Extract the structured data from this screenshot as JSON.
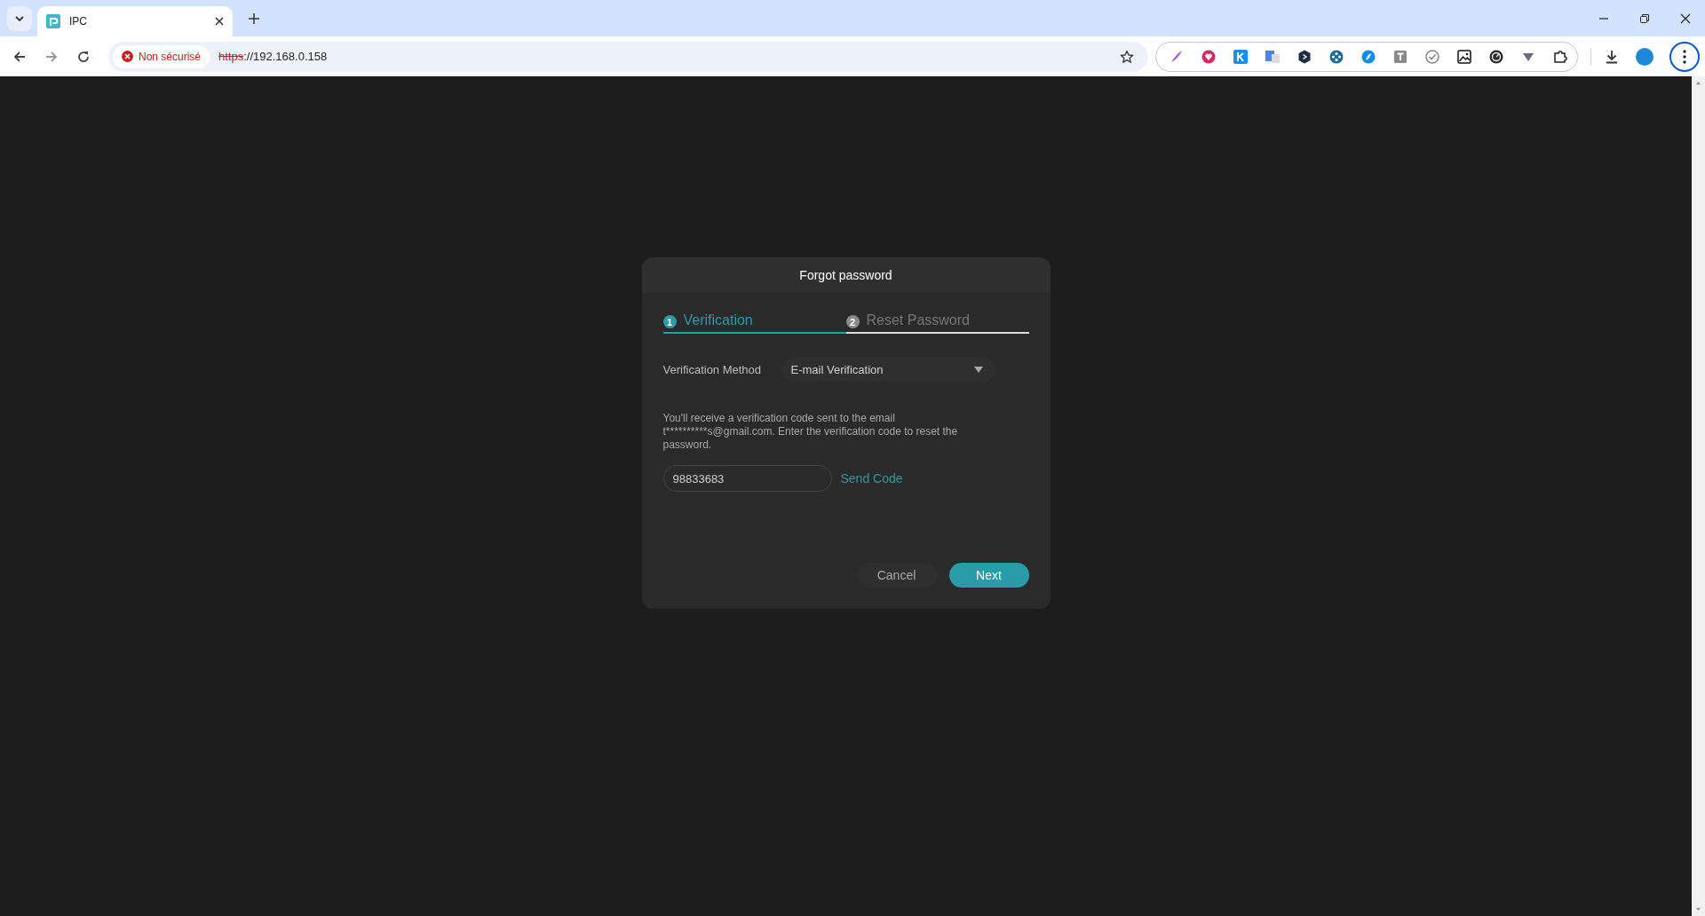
{
  "browser": {
    "tabs": [
      {
        "title": "IPC",
        "selected": true
      }
    ],
    "address": {
      "security": "Non sécurisé",
      "scheme": "https",
      "rest": "://192.168.0.158"
    }
  },
  "dialog": {
    "title": "Forgot password",
    "steps": [
      {
        "number": "1",
        "label": "Verification",
        "selected": true
      },
      {
        "number": "2",
        "label": "Reset Password",
        "selected": false
      }
    ],
    "method": {
      "label": "Verification Method",
      "value": "E-mail Verification"
    },
    "message": "You'll receive a verification code sent to the email t**********s@gmail.com. Enter the verification code to reset the password.",
    "code": {
      "value": "98833683"
    },
    "send_code": "Send Code",
    "buttons": [
      {
        "label": "Cancel",
        "kind": "secondary"
      },
      {
        "label": "Next",
        "kind": "primary"
      }
    ]
  }
}
